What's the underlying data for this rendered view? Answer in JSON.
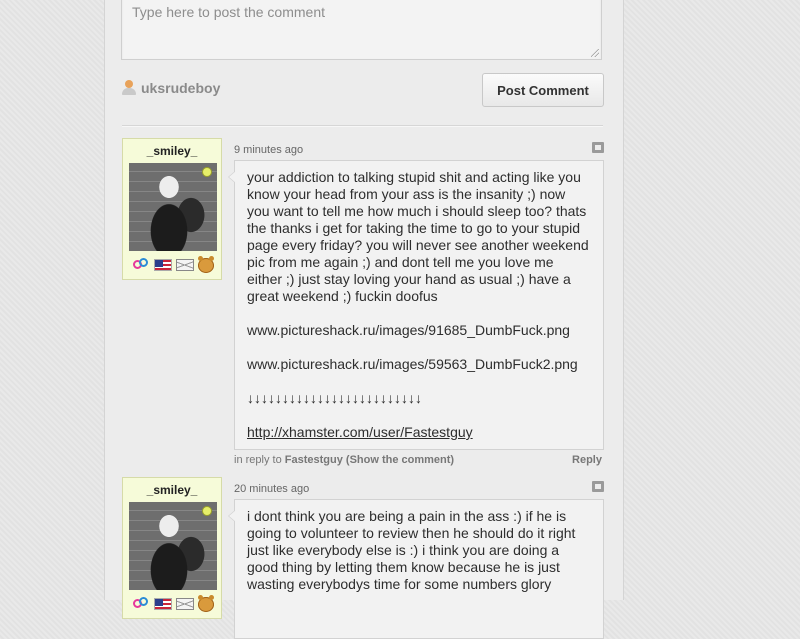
{
  "composer": {
    "placeholder": "Type here to post the comment",
    "username": "uksrudeboy",
    "post_label": "Post Comment"
  },
  "comments": [
    {
      "author": "_smiley_",
      "time": "9 minutes ago",
      "paragraphs": [
        "your addiction to talking stupid shit and acting like you know your head from your ass is the insanity ;) now you want to tell me how much i should sleep too? thats the thanks i get for taking the time to go to your stupid page every friday? you will never see another weekend pic from me again ;) and dont tell me you love me either ;) just stay loving your hand as usual ;) have a great weekend ;) fuckin doofus",
        "www.pictureshack.ru/images/91685_DumbFuck.png",
        "www.pictureshack.ru/images/59563_DumbFuck2.png",
        "↓↓↓↓↓↓↓↓↓↓↓↓↓↓↓↓↓↓↓↓↓↓↓↓↓"
      ],
      "link": "http://xhamster.com/user/Fastestguy",
      "in_reply_prefix": "in reply to",
      "in_reply_user": "Fastestguy",
      "show_comment": "(Show the comment)",
      "reply_label": "Reply"
    },
    {
      "author": "_smiley_",
      "time": "20 minutes ago",
      "paragraphs": [
        "i dont think you are being a pain in the ass :) if he is going to volunteer to review then he should do it right just like everybody else is :) i think you are doing a good thing by letting them know because he is just wasting everybodys time for some numbers glory"
      ]
    }
  ],
  "icons": {
    "user": "user-icon",
    "gender": "couple-gender-icon",
    "flag": "us-flag-icon",
    "mail": "envelope-icon",
    "face": "monkey-face-icon",
    "report": "report-flag-icon",
    "online": "online-status-icon"
  }
}
